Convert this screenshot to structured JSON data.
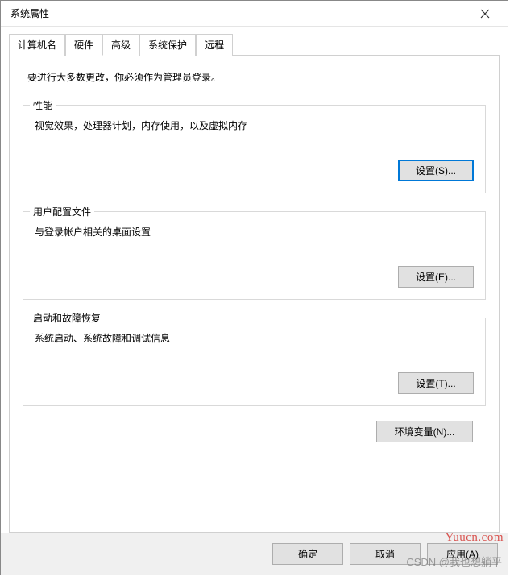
{
  "window": {
    "title": "系统属性"
  },
  "tabs": {
    "computer_name": "计算机名",
    "hardware": "硬件",
    "advanced": "高级",
    "system_protection": "系统保护",
    "remote": "远程"
  },
  "advanced_tab": {
    "admin_note": "要进行大多数更改，你必须作为管理员登录。",
    "performance": {
      "title": "性能",
      "desc": "视觉效果，处理器计划，内存使用，以及虚拟内存",
      "button": "设置(S)..."
    },
    "user_profiles": {
      "title": "用户配置文件",
      "desc": "与登录帐户相关的桌面设置",
      "button": "设置(E)..."
    },
    "startup_recovery": {
      "title": "启动和故障恢复",
      "desc": "系统启动、系统故障和调试信息",
      "button": "设置(T)..."
    },
    "env_vars_button": "环境变量(N)..."
  },
  "footer": {
    "ok": "确定",
    "cancel": "取消",
    "apply": "应用(A)"
  },
  "watermarks": {
    "w1": "Yuucn.com",
    "w2": "CSDN @我也想躺平"
  }
}
